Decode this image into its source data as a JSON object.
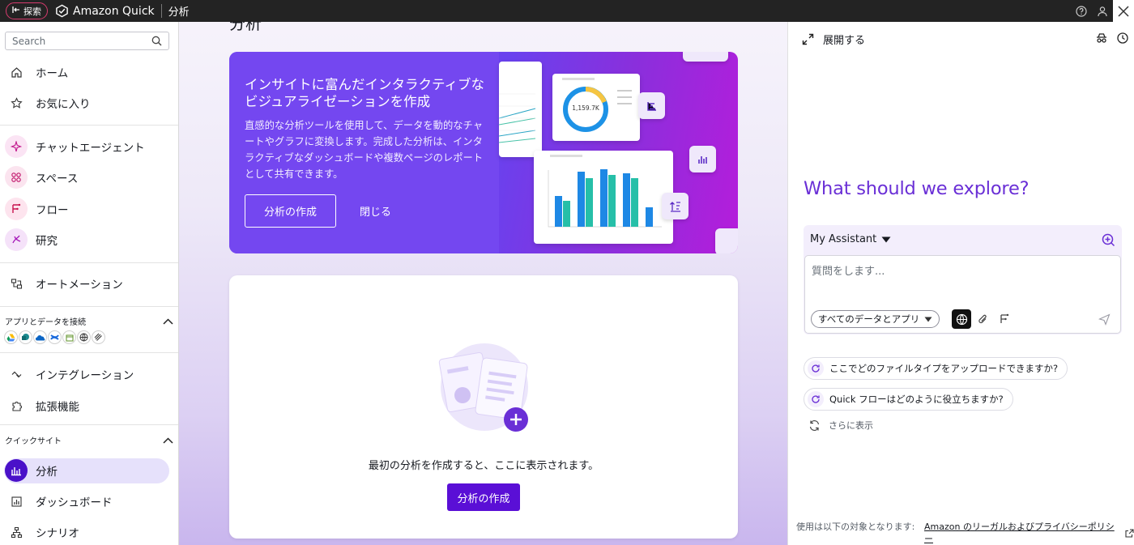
{
  "topbar": {
    "explore_label": "探索",
    "product_name": "Amazon Quick",
    "page_name": "分析"
  },
  "sidebar": {
    "search_placeholder": "Search",
    "nav_primary": [
      {
        "label": "ホーム",
        "icon": "home-icon"
      },
      {
        "label": "お気に入り",
        "icon": "star-icon"
      }
    ],
    "nav_agents": [
      {
        "label": "チャットエージェント",
        "icon": "chat-agent-icon"
      },
      {
        "label": "スペース",
        "icon": "spaces-icon"
      },
      {
        "label": "フロー",
        "icon": "flows-icon"
      },
      {
        "label": "研究",
        "icon": "research-icon"
      }
    ],
    "automation_label": "オートメーション",
    "connect_section_title": "アプリとデータを接続",
    "integrations_label": "インテグレーション",
    "extensions_label": "拡張機能",
    "quicksight_section_title": "クイックサイト",
    "quicksight_items": [
      {
        "label": "分析",
        "icon": "analysis-icon",
        "active": true
      },
      {
        "label": "ダッシュボード",
        "icon": "dashboard-icon",
        "active": false
      },
      {
        "label": "シナリオ",
        "icon": "scenario-icon",
        "active": false
      }
    ]
  },
  "main": {
    "title": "分析",
    "hero": {
      "title": "インサイトに富んだインタラクティブなビジュアライゼーションを作成",
      "description": "直感的な分析ツールを使用して、データを動的なチャートやグラフに変換します。完成した分析は、インタラクティブなダッシュボードや複数ページのレポートとして共有できます。",
      "primary_action": "分析の作成",
      "dismiss_action": "閉じる",
      "donut_value": "1,159.7K"
    },
    "empty_state": {
      "message": "最初の分析を作成すると、ここに表示されます。",
      "action": "分析の作成"
    }
  },
  "assistant_panel": {
    "expand_label": "展開する",
    "headline": "What should we explore?",
    "assistant_name": "My Assistant",
    "input_placeholder": "質問をします...",
    "source_selector": "すべてのデータとアプリ",
    "suggestions": [
      "ここでどのファイルタイプをアップロードできますか?",
      "Quick フローはどのように役立ちますか?"
    ],
    "show_more": "さらに表示",
    "footer_text": "使用は以下の対象となります:",
    "footer_link": "Amazon のリーガルおよびプライバシーポリシー"
  },
  "colors": {
    "accent": "#5a0fd6",
    "headline": "#6a2fd6",
    "hero_bg": "#7447f0",
    "active_nav_bg": "#e6e1fb"
  }
}
